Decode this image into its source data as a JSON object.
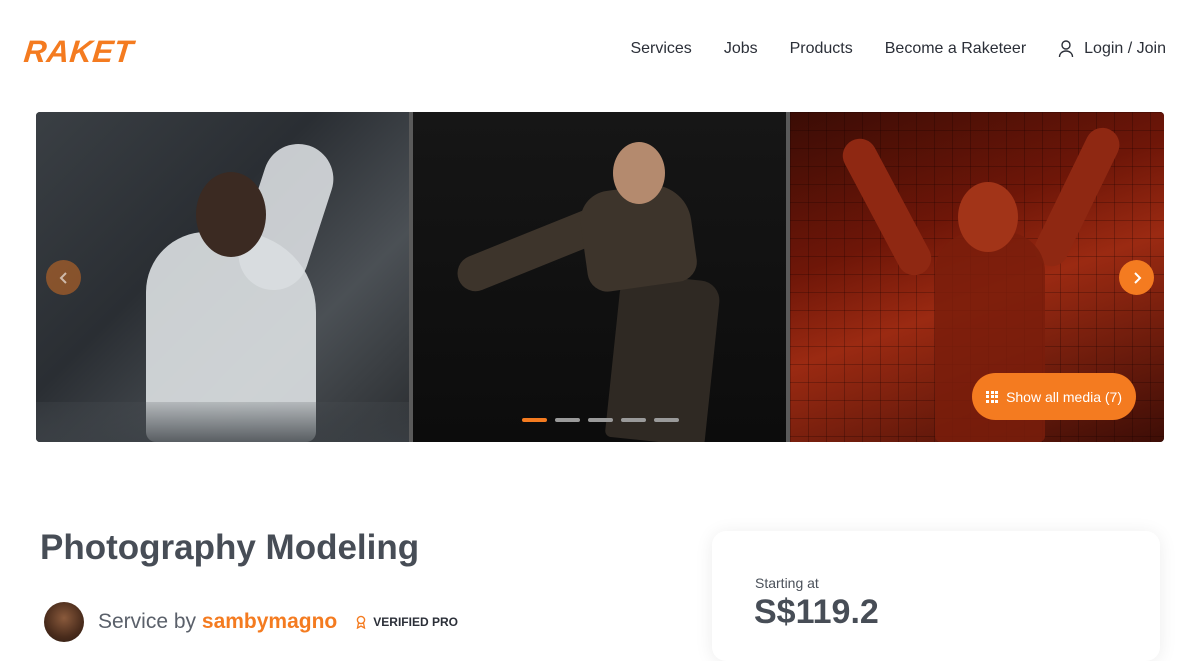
{
  "header": {
    "logo": "RAKET",
    "nav": [
      "Services",
      "Jobs",
      "Products",
      "Become a Raketeer"
    ],
    "login_label": "Login / Join"
  },
  "gallery": {
    "show_media_label": "Show all media (7)",
    "slide_count": 5,
    "active_slide": 1
  },
  "service": {
    "title": "Photography Modeling",
    "service_by_label": "Service by",
    "provider": "sambymagno",
    "badge": "VERIFIED PRO"
  },
  "pricing": {
    "starting_label": "Starting at",
    "price": "S$119.2"
  },
  "colors": {
    "brand": "#f47b20",
    "text": "#474d56"
  }
}
